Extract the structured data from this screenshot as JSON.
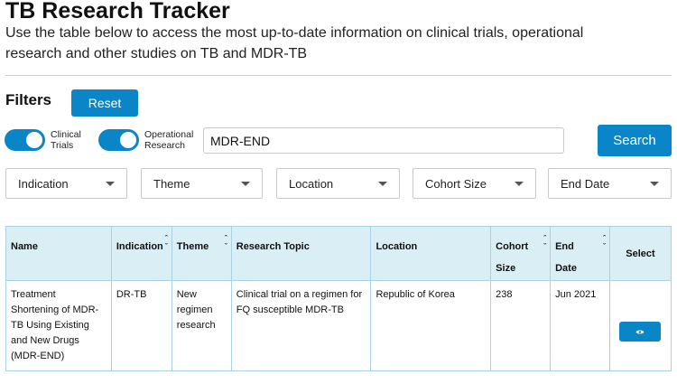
{
  "header": {
    "title": "TB Research Tracker",
    "subtitle": "Use the table below to access the most up-to-date information on clinical trials, operational research and other studies on TB and MDR-TB"
  },
  "filters": {
    "label": "Filters",
    "reset_label": "Reset",
    "toggles": [
      {
        "label_line1": "Clinical",
        "label_line2": "Trials",
        "on": true
      },
      {
        "label_line1": "Operational",
        "label_line2": "Research",
        "on": true
      }
    ],
    "search": {
      "value": "MDR-END",
      "button_label": "Search"
    },
    "dropdowns": [
      "Indication",
      "Theme",
      "Location",
      "Cohort Size",
      "End Date"
    ]
  },
  "table": {
    "columns": {
      "name": "Name",
      "indication": "Indication",
      "theme": "Theme",
      "topic": "Research Topic",
      "location": "Location",
      "cohort_l1": "Cohort",
      "cohort_l2": "Size",
      "end_l1": "End",
      "end_l2": "Date",
      "select": "Select"
    },
    "rows": [
      {
        "name": "Treatment Shortening of MDR-TB Using Existing and New Drugs (MDR-END)",
        "indication": "DR-TB",
        "theme": "New regimen research",
        "topic": "Clinical trial on a regimen for FQ susceptible MDR-TB",
        "location": "Republic of Korea",
        "cohort_size": "238",
        "end_date": "Jun 2021"
      }
    ]
  },
  "icons": {
    "view": "eye-icon",
    "sort": "sort-arrows-icon",
    "dropdown": "caret-down-icon"
  },
  "colors": {
    "accent": "#0a86c8",
    "table_header": "#daeef6",
    "table_border": "#a9d3e4"
  }
}
